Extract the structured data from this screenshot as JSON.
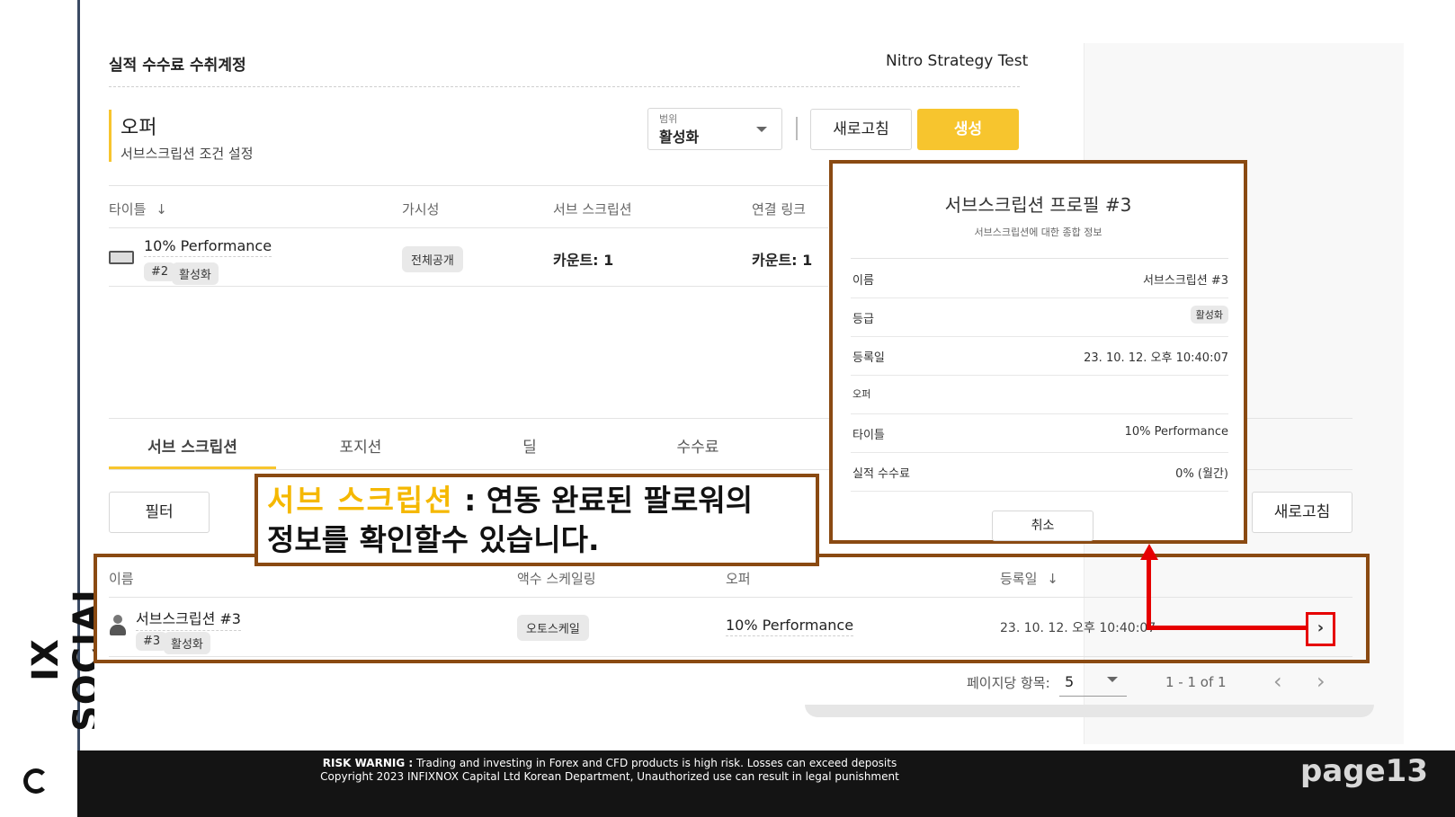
{
  "brand": {
    "name": "IX SOCIAL"
  },
  "header": {
    "title": "실적 수수료 수취계정",
    "strategy": "Nitro Strategy Test"
  },
  "offer": {
    "title": "오퍼",
    "subtitle": "서브스크립션 조건 설정"
  },
  "scope": {
    "label": "범위",
    "value": "활성화"
  },
  "buttons": {
    "refresh": "새로고침",
    "create": "생성",
    "filter": "필터",
    "refresh2": "새로고침",
    "cancel": "취소"
  },
  "offer_table": {
    "columns": [
      "타이틀",
      "가시성",
      "서브 스크립션",
      "연결 링크"
    ],
    "rows": [
      {
        "title": "10% Performance",
        "id": "#2",
        "status": "활성화",
        "visibility": "전체공개",
        "subscriptions": "카운트: 1",
        "links": "카운트: 1"
      }
    ]
  },
  "tabs": [
    "서브 스크립션",
    "포지션",
    "딜",
    "수수료"
  ],
  "sub_table": {
    "columns": [
      "이름",
      "액수 스케일링",
      "오퍼",
      "등록일"
    ],
    "rows": [
      {
        "name": "서브스크립션 #3",
        "id": "#3",
        "status": "활성화",
        "scaling": "오토스케일",
        "offer": "10% Performance",
        "date": "23. 10. 12. 오후 10:40:07"
      }
    ]
  },
  "pagination": {
    "per_page_label": "페이지당 항목:",
    "per_page": "5",
    "range": "1 - 1 of 1"
  },
  "modal": {
    "title": "서브스크립션 프로필 #3",
    "subtitle": "서브스크립션에 대한 종합 정보",
    "rows": [
      {
        "k": "이름",
        "v": "서브스크립션 #3"
      },
      {
        "k": "등급",
        "v": "활성화"
      },
      {
        "k": "등록일",
        "v": "23. 10. 12. 오후 10:40:07"
      },
      {
        "k": "오퍼",
        "v": ""
      },
      {
        "k": "타이틀",
        "v": "10% Performance"
      },
      {
        "k": "실적 수수료",
        "v": "0% (월간)"
      }
    ]
  },
  "callout": {
    "highlight": "서브 스크립션",
    "line1": " : 연동 완료된 팔로워의",
    "line2": "정보를 확인할수 있습니다."
  },
  "footer": {
    "line1_bold": "RISK WARNIG :",
    "line1": " Trading and investing in Forex and CFD products is high risk. Losses can exceed deposits",
    "line2": "Copyright 2023 INFIXNOX Capital Ltd Korean Department, Unauthorized use can result in legal punishment",
    "page": "page13"
  },
  "colors": {
    "accent": "#f7c52e",
    "callout_border": "#8a4a12",
    "arrow": "#e60000"
  }
}
